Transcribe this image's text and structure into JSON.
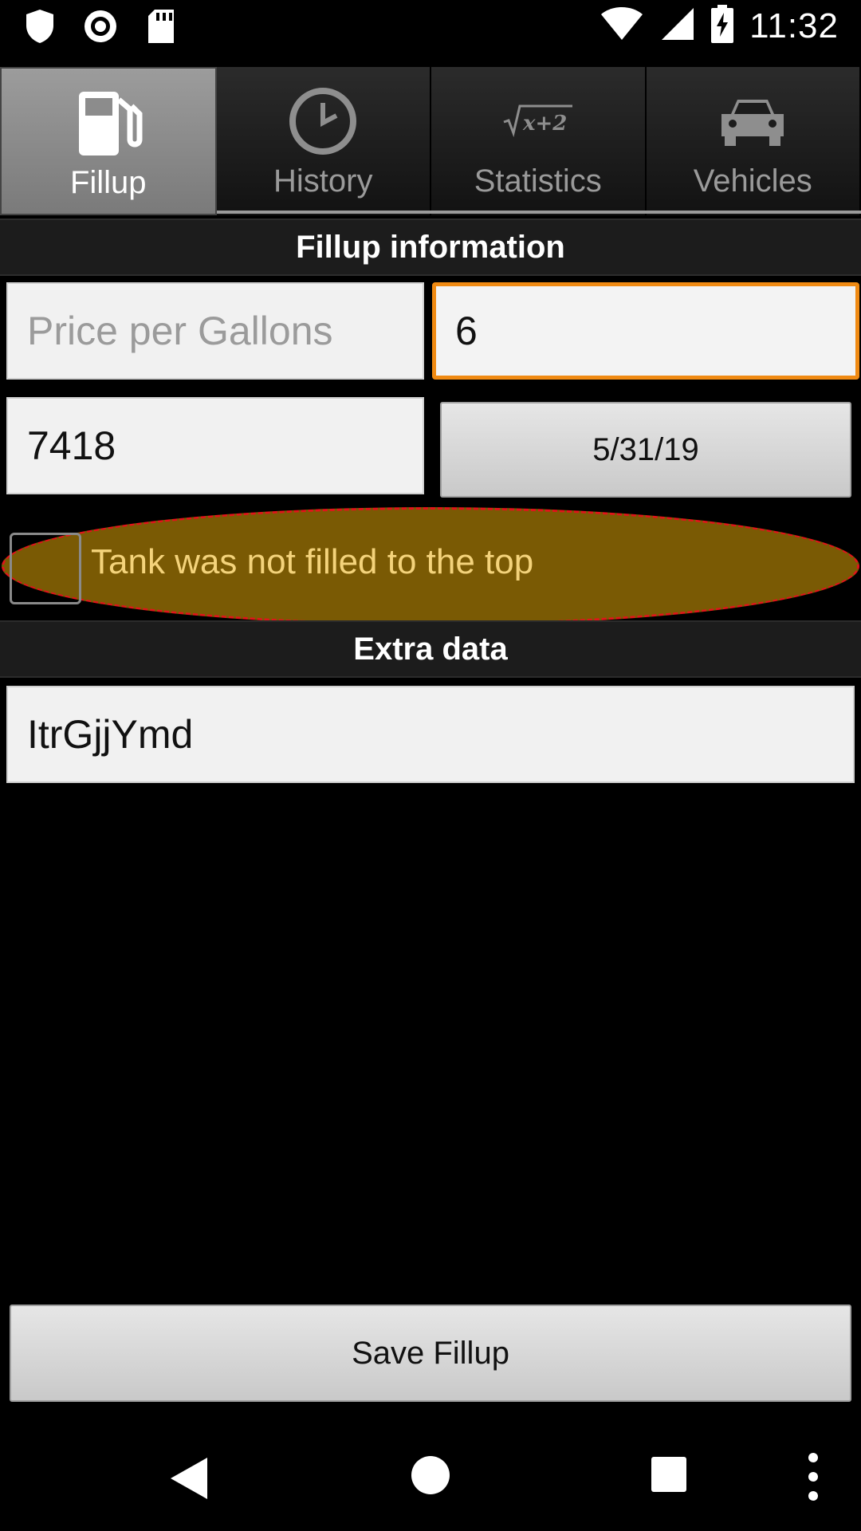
{
  "status_bar": {
    "time": "11:32",
    "left_icons": [
      "shield-icon",
      "record-icon",
      "sd-card-icon"
    ],
    "right_icons": [
      "wifi-icon",
      "cell-signal-icon",
      "battery-charging-icon"
    ]
  },
  "tabs": [
    {
      "label": "Fillup",
      "icon": "fuel-pump-icon",
      "active": true
    },
    {
      "label": "History",
      "icon": "clock-icon",
      "active": false
    },
    {
      "label": "Statistics",
      "icon": "sqrt-formula-icon",
      "active": false
    },
    {
      "label": "Vehicles",
      "icon": "car-icon",
      "active": false
    }
  ],
  "fillup_section": {
    "title": "Fillup information",
    "price_field": {
      "value": "",
      "placeholder": "Price per Gallons"
    },
    "gallons_field": {
      "value": "6"
    },
    "odometer_field": {
      "value": "7418"
    },
    "date_button": "5/31/19",
    "partial_checkbox": {
      "label": "Tank was not filled to the top",
      "checked": false
    }
  },
  "extra_section": {
    "title": "Extra data",
    "comment_field": {
      "value": "ItrGjjYmd"
    }
  },
  "save_button": "Save Fillup",
  "colors": {
    "focus": "#f08a12",
    "highlight_fill": "#7a5a04",
    "highlight_border": "#e0151a",
    "checkbox_label": "#f4d37b"
  },
  "navbar": {
    "icons": [
      "back-icon",
      "home-icon",
      "recents-icon",
      "more-icon"
    ]
  }
}
